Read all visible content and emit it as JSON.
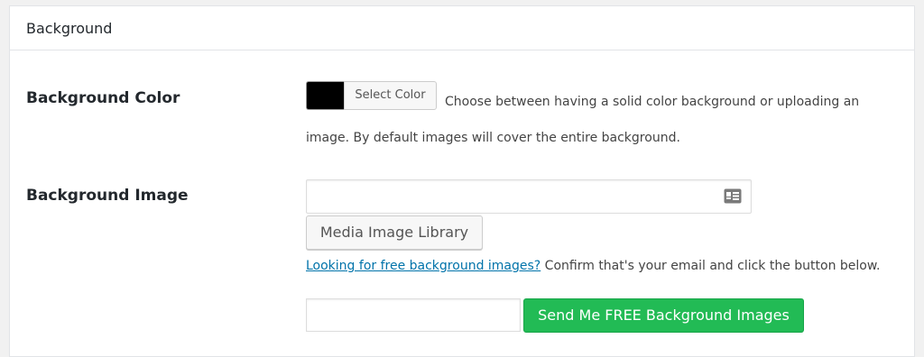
{
  "section": {
    "title": "Background"
  },
  "background_color": {
    "label": "Background Color",
    "swatch_color": "#000000",
    "select_button_label": "Select Color",
    "description": "Choose between having a solid color background or uploading an image. By default images will cover the entire background."
  },
  "background_image": {
    "label": "Background Image",
    "url_value": "",
    "url_icon": "id-card-icon",
    "media_button_label": "Media Image Library",
    "free_link_text": "Looking for free background images?",
    "free_followup_text": " Confirm that's your email and click the button below.",
    "email_value": "",
    "send_button_label": "Send Me FREE Background Images",
    "send_button_color": "#22bb55",
    "link_color": "#0073aa"
  }
}
